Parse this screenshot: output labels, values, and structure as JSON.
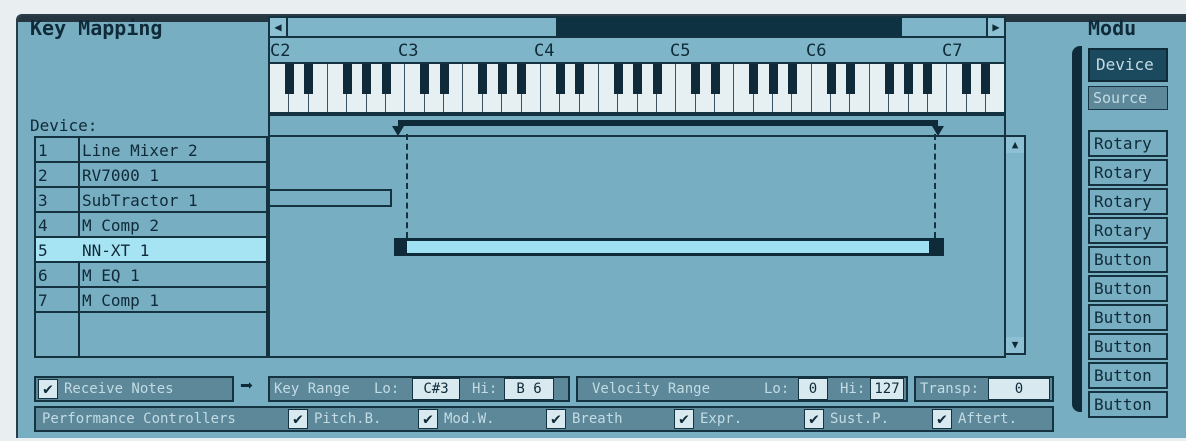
{
  "title": "Key Mapping",
  "octave_labels": [
    "C2",
    "C3",
    "C4",
    "C5",
    "C6",
    "C7"
  ],
  "device_label": "Device:",
  "devices": [
    {
      "num": "1",
      "name": "Line Mixer 2"
    },
    {
      "num": "2",
      "name": "RV7000 1"
    },
    {
      "num": "3",
      "name": "SubTractor 1"
    },
    {
      "num": "4",
      "name": "M Comp 2"
    },
    {
      "num": "5",
      "name": "NN-XT 1",
      "selected": true
    },
    {
      "num": "6",
      "name": "M EQ 1"
    },
    {
      "num": "7",
      "name": "M Comp 1"
    }
  ],
  "receive_notes": {
    "label": "Receive Notes",
    "checked": true
  },
  "key_range": {
    "label": "Key Range",
    "lo_label": "Lo:",
    "lo": "C#3",
    "hi_label": "Hi:",
    "hi": "B 6"
  },
  "velocity_range": {
    "label": "Velocity Range",
    "lo_label": "Lo:",
    "lo": "0",
    "hi_label": "Hi:",
    "hi": "127"
  },
  "transpose": {
    "label": "Transp:",
    "value": "0"
  },
  "performance": {
    "label": "Performance Controllers",
    "items": [
      {
        "label": "Pitch.B.",
        "checked": true
      },
      {
        "label": "Mod.W.",
        "checked": true
      },
      {
        "label": "Breath",
        "checked": true
      },
      {
        "label": "Expr.",
        "checked": true
      },
      {
        "label": "Sust.P.",
        "checked": true
      },
      {
        "label": "Aftert.",
        "checked": true
      }
    ]
  },
  "modulation": {
    "title": "Modu",
    "header": "Device",
    "source": "Source",
    "items": [
      "Rotary",
      "Rotary",
      "Rotary",
      "Rotary",
      "Button",
      "Button",
      "Button",
      "Button",
      "Button",
      "Button"
    ]
  },
  "check_glyph": "✔",
  "arrow_glyph": "➡",
  "colors": {
    "panel": "#78aec1",
    "dark": "#0f2a38",
    "selected": "#a6e3f3",
    "button": "#5c8899"
  }
}
